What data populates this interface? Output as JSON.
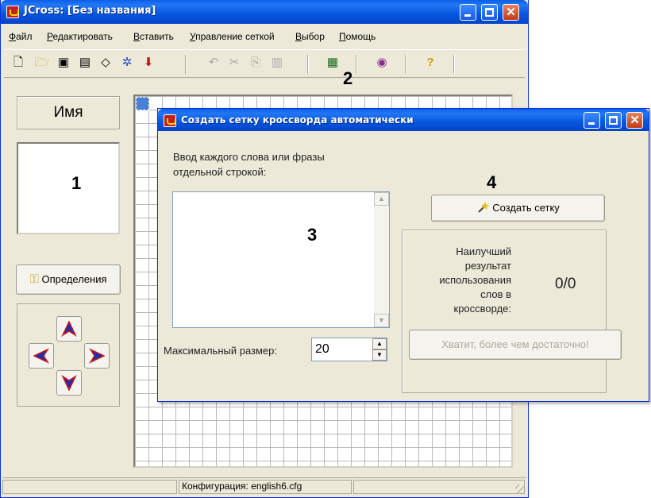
{
  "main_window": {
    "title": "JCross: [Без названия]",
    "menu": [
      {
        "accel": "Ф",
        "rest": "айл"
      },
      {
        "accel": "Р",
        "rest": "едактировать"
      },
      {
        "accel": "В",
        "rest": "ставить"
      },
      {
        "accel": "У",
        "rest": "правление сеткой"
      },
      {
        "accel": "В",
        "rest": "ыбор"
      },
      {
        "accel": "П",
        "rest": "омощь"
      }
    ],
    "toolbar_icons": [
      "new-icon",
      "open-icon",
      "save-icon",
      "save-as-icon",
      "erase-icon",
      "auto-fill-icon",
      "pin-icon",
      "undo-icon",
      "cut-icon",
      "copy-icon",
      "paste-icon",
      "grid-icon",
      "palette-icon",
      "help-icon"
    ],
    "name_label": "Имя",
    "definitions_button": "Определения",
    "status_config": "Конфигурация: english6.cfg"
  },
  "dialog": {
    "title": "Создать сетку кроссворда автоматически",
    "instruction_line1": "Ввод каждого слова или фразы",
    "instruction_line2": "отдельной строкой:",
    "words_value": "",
    "max_size_label": "Максимальный размер:",
    "max_size_value": "20",
    "create_button": "Создать сетку",
    "result_label_lines": [
      "Наилучший",
      "результат",
      "использования",
      "слов в",
      "кроссворде:"
    ],
    "result_value": "0/0",
    "enough_button": "Хватит, более чем достаточно!"
  },
  "callouts": {
    "c1": "1",
    "c2": "2",
    "c3": "3",
    "c4": "4"
  },
  "colors": {
    "title_blue": "#0556de",
    "window_face": "#ece9d8",
    "close_red": "#c23a18",
    "arrow_blue": "#1a2fb0",
    "arrow_red": "#d01818"
  }
}
